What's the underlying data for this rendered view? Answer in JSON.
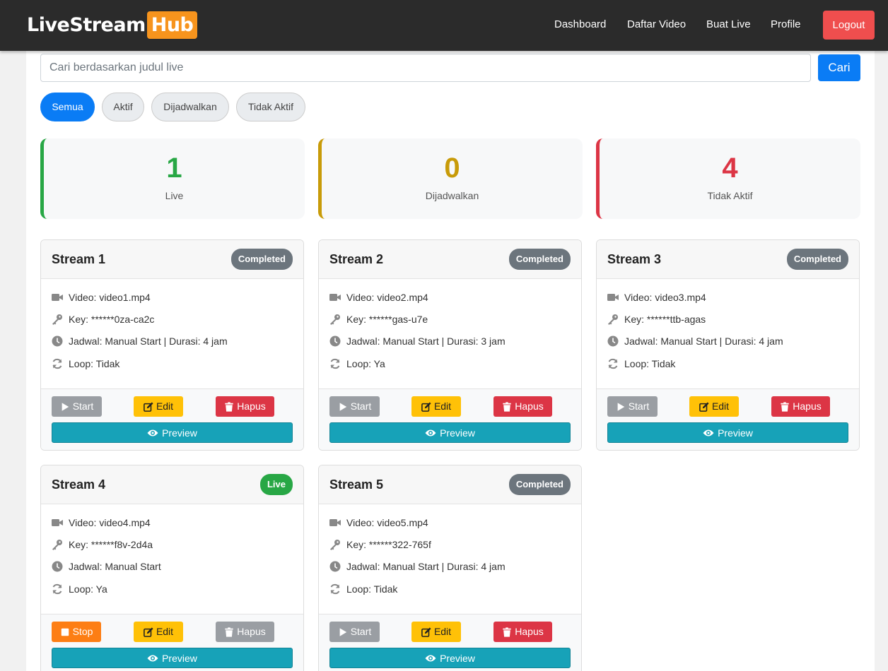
{
  "brand": {
    "main": "LiveStream",
    "accent": "Hub"
  },
  "nav": {
    "items": [
      "Dashboard",
      "Daftar Video",
      "Buat Live",
      "Profile"
    ],
    "logout": "Logout"
  },
  "search": {
    "placeholder": "Cari berdasarkan judul live",
    "button": "Cari"
  },
  "filters": [
    "Semua",
    "Aktif",
    "Dijadwalkan",
    "Tidak Aktif"
  ],
  "stats": [
    {
      "value": "1",
      "label": "Live",
      "color": "#28a745"
    },
    {
      "value": "0",
      "label": "Dijadwalkan",
      "color": "#c89b09"
    },
    {
      "value": "4",
      "label": "Tidak Aktif",
      "color": "#dc3545"
    }
  ],
  "buttons": {
    "start": "Start",
    "stop": "Stop",
    "edit": "Edit",
    "delete": "Hapus",
    "preview": "Preview"
  },
  "streams": [
    {
      "title": "Stream 1",
      "status": "Completed",
      "video": "Video: video1.mp4",
      "key": "Key: ******0za-ca2c",
      "schedule": "Jadwal: Manual Start | Durasi: 4 jam",
      "loop": "Loop: Tidak"
    },
    {
      "title": "Stream 2",
      "status": "Completed",
      "video": "Video: video2.mp4",
      "key": "Key: ******gas-u7e",
      "schedule": "Jadwal: Manual Start | Durasi: 3 jam",
      "loop": "Loop: Ya"
    },
    {
      "title": "Stream 3",
      "status": "Completed",
      "video": "Video: video3.mp4",
      "key": "Key: ******ttb-agas",
      "schedule": "Jadwal: Manual Start | Durasi: 4 jam",
      "loop": "Loop: Tidak"
    },
    {
      "title": "Stream 4",
      "status": "Live",
      "video": "Video: video4.mp4",
      "key": "Key: ******f8v-2d4a",
      "schedule": "Jadwal: Manual Start",
      "loop": "Loop: Ya"
    },
    {
      "title": "Stream 5",
      "status": "Completed",
      "video": "Video: video5.mp4",
      "key": "Key: ******322-765f",
      "schedule": "Jadwal: Manual Start | Durasi: 4 jam",
      "loop": "Loop: Tidak"
    }
  ]
}
